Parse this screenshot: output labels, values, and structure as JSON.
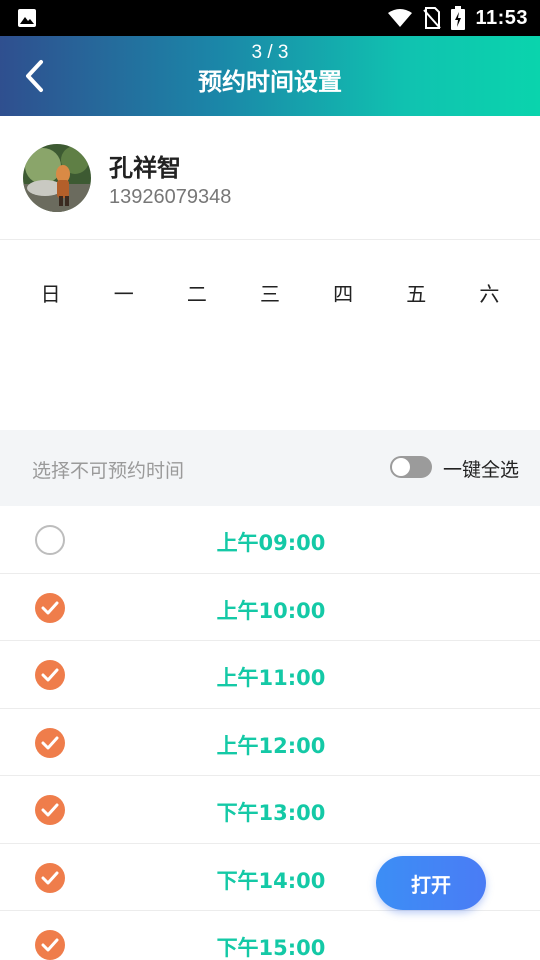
{
  "status_bar": {
    "time": "11:53"
  },
  "header": {
    "step": "3 / 3",
    "title": "预约时间设置"
  },
  "profile": {
    "name": "孔祥智",
    "phone": "13926079348"
  },
  "weekdays": [
    "日",
    "一",
    "二",
    "三",
    "四",
    "五",
    "六"
  ],
  "select_bar": {
    "hint": "选择不可预约时间",
    "select_all_label": "一键全选",
    "select_all_on": false
  },
  "time_slots": [
    {
      "label": "上午09:00",
      "checked": false
    },
    {
      "label": "上午10:00",
      "checked": true
    },
    {
      "label": "上午11:00",
      "checked": true
    },
    {
      "label": "上午12:00",
      "checked": true
    },
    {
      "label": "下午13:00",
      "checked": true
    },
    {
      "label": "下午14:00",
      "checked": true
    },
    {
      "label": "下午15:00",
      "checked": true
    }
  ],
  "fab": {
    "label": "打开"
  },
  "colors": {
    "accent_teal": "#14c9a6",
    "check_orange": "#ef7d4b",
    "fab_blue": "#4a7cf5"
  },
  "icons": [
    "gallery-icon",
    "wifi-icon",
    "no-sim-icon",
    "battery-icon",
    "back-arrow-icon",
    "check-icon"
  ]
}
